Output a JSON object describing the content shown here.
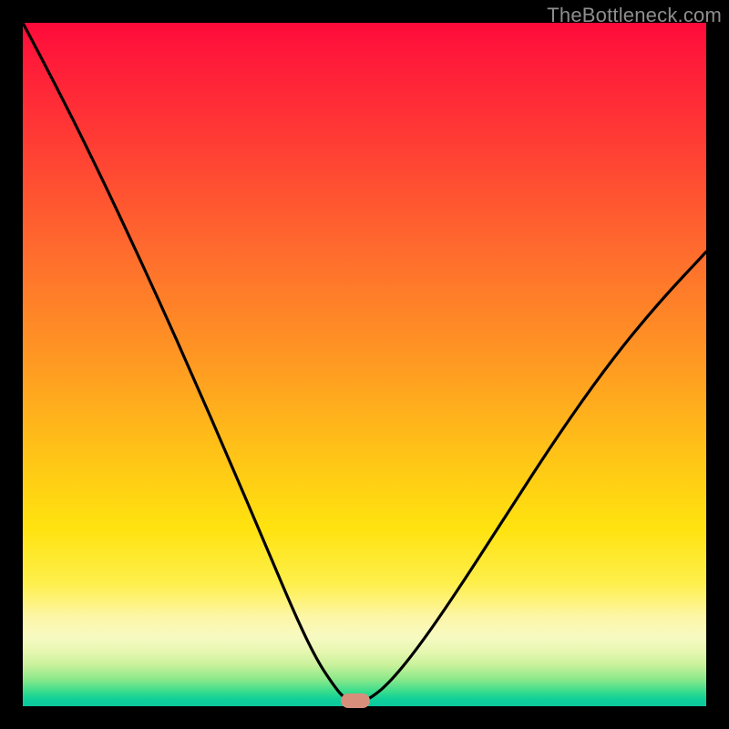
{
  "watermark": "TheBottleneck.com",
  "marker": {
    "x_frac": 0.4867,
    "y_frac": 0.992
  },
  "chart_data": {
    "type": "line",
    "title": "",
    "xlabel": "",
    "ylabel": "",
    "xlim": [
      0,
      1
    ],
    "ylim": [
      0,
      1
    ],
    "series": [
      {
        "name": "bottleneck-curve",
        "x": [
          0.0,
          0.05,
          0.1,
          0.15,
          0.2,
          0.25,
          0.3,
          0.35,
          0.4,
          0.43,
          0.455,
          0.47,
          0.487,
          0.51,
          0.54,
          0.58,
          0.63,
          0.7,
          0.78,
          0.86,
          0.93,
          1.0
        ],
        "y": [
          1.0,
          0.905,
          0.805,
          0.7,
          0.592,
          0.48,
          0.365,
          0.248,
          0.13,
          0.068,
          0.03,
          0.012,
          0.003,
          0.012,
          0.038,
          0.088,
          0.16,
          0.268,
          0.392,
          0.505,
          0.59,
          0.665
        ],
        "note": "y is fractional height from the bottom (0) to top (1) of the plot area; x is fractional width. Values estimated from pixels; no axes/ticks present in source."
      }
    ],
    "annotations": [
      {
        "kind": "min-marker",
        "x": 0.487,
        "y": 0.008
      }
    ],
    "background": "vertical red→yellow→green gradient",
    "grid": false,
    "legend": false
  }
}
